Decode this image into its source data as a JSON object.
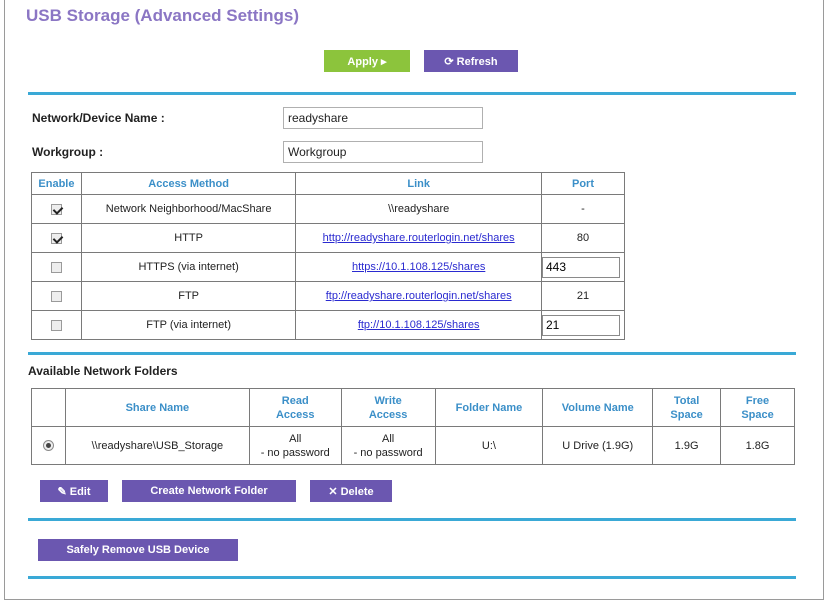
{
  "page": {
    "title": "USB Storage (Advanced Settings)"
  },
  "toolbar": {
    "apply_label": "Apply ▸",
    "refresh_label": "⟳ Refresh"
  },
  "form": {
    "device_name_label": "Network/Device Name :",
    "device_name_value": "readyshare",
    "workgroup_label": "Workgroup :",
    "workgroup_value": "Workgroup"
  },
  "access_table": {
    "headers": [
      "Enable",
      "Access Method",
      "Link",
      "Port"
    ],
    "rows": [
      {
        "enabled": true,
        "method": "Network Neighborhood/MacShare",
        "link": "\\\\readyshare",
        "link_is_url": false,
        "port": "-",
        "port_editable": false
      },
      {
        "enabled": true,
        "method": "HTTP",
        "link": "http://readyshare.routerlogin.net/shares",
        "link_is_url": true,
        "port": "80",
        "port_editable": false
      },
      {
        "enabled": false,
        "method": "HTTPS (via internet)",
        "link": "https://10.1.108.125/shares",
        "link_is_url": true,
        "port": "443",
        "port_editable": true
      },
      {
        "enabled": false,
        "method": "FTP",
        "link": "ftp://readyshare.routerlogin.net/shares",
        "link_is_url": true,
        "port": "21",
        "port_editable": false
      },
      {
        "enabled": false,
        "method": "FTP (via internet)",
        "link": "ftp://10.1.108.125/shares",
        "link_is_url": true,
        "port": "21",
        "port_editable": true
      }
    ]
  },
  "folders": {
    "section_title": "Available Network Folders",
    "headers": {
      "share_name": "Share Name",
      "read_access": [
        "Read",
        "Access"
      ],
      "write_access": [
        "Write",
        "Access"
      ],
      "folder_name": "Folder Name",
      "volume_name": "Volume Name",
      "total_space": [
        "Total",
        "Space"
      ],
      "free_space": [
        "Free",
        "Space"
      ]
    },
    "rows": [
      {
        "selected": true,
        "share_name": "\\\\readyshare\\USB_Storage",
        "read_access": [
          "All",
          "- no password"
        ],
        "write_access": [
          "All",
          "- no password"
        ],
        "folder_name": "U:\\",
        "volume_name": "U Drive (1.9G)",
        "total_space": "1.9G",
        "free_space": "1.8G"
      }
    ],
    "buttons": {
      "edit": "✎ Edit",
      "create": "Create Network Folder",
      "delete": "✕ Delete"
    }
  },
  "footer": {
    "remove_usb_label": "Safely Remove USB Device"
  },
  "colors": {
    "accent_green": "#8cc43c",
    "accent_purple": "#6b57b0",
    "rule_blue": "#3aa9d6",
    "header_blue": "#3b8fc8",
    "title_purple": "#8b76c4"
  }
}
